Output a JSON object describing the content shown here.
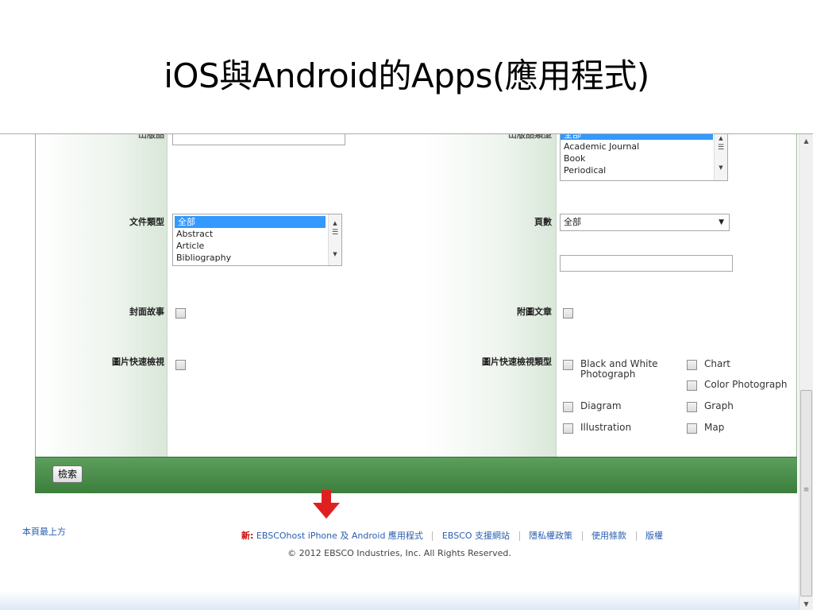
{
  "slide": {
    "title": "iOS與Android的Apps(應用程式)"
  },
  "form": {
    "top_left_label": "出版品",
    "top_right_label": "出版品類型",
    "publication_type_options": [
      {
        "label": "全部",
        "selected": true
      },
      {
        "label": "Academic Journal",
        "selected": false
      },
      {
        "label": "Book",
        "selected": false
      },
      {
        "label": "Periodical",
        "selected": false
      }
    ],
    "document_type": {
      "label": "文件類型",
      "options": [
        {
          "label": "全部",
          "selected": true
        },
        {
          "label": "Abstract",
          "selected": false
        },
        {
          "label": "Article",
          "selected": false
        },
        {
          "label": "Bibliography",
          "selected": false
        }
      ]
    },
    "pages": {
      "label": "頁數",
      "selected": "全部"
    },
    "cover_story": {
      "label": "封面故事"
    },
    "article_with_images": {
      "label": "附圖文章"
    },
    "image_quick_view": {
      "label": "圖片快速檢視"
    },
    "image_quick_view_types": {
      "label": "圖片快速檢視類型",
      "options": [
        "Black and White Photograph",
        "Chart",
        "Color Photograph",
        "Diagram",
        "Graph",
        "Illustration",
        "Map"
      ]
    },
    "search_button": "檢索"
  },
  "footer": {
    "back_to_top": "本頁最上方",
    "new_label": "新:",
    "links": [
      "EBSCOhost iPhone 及 Android 應用程式",
      "EBSCO 支援網站",
      "隱私權政策",
      "使用條款",
      "版權"
    ],
    "copyright": "© 2012 EBSCO Industries, Inc. All Rights Reserved."
  },
  "colors": {
    "accent_green": "#3c7e3c",
    "highlight_blue": "#3399ff",
    "arrow_red": "#e02020",
    "link_blue": "#2a5db0"
  }
}
